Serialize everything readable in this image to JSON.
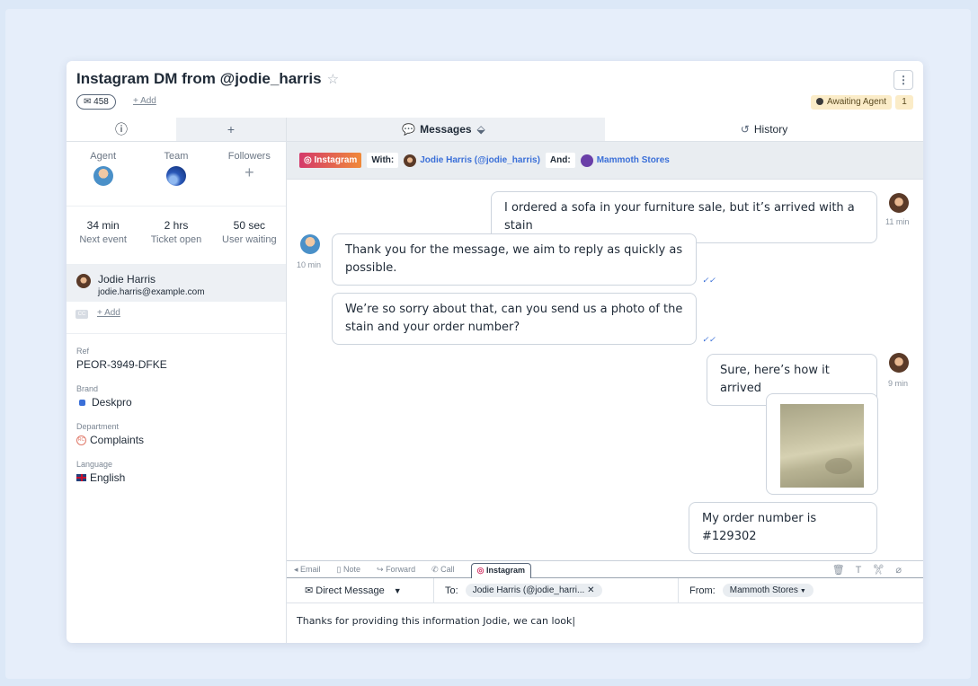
{
  "ticket": {
    "title": "Instagram DM from @jodie_harris",
    "star_icon": "star-icon",
    "message_count": "458",
    "add_label": "+ Add",
    "status": "Awaiting Agent",
    "status_count": "1",
    "more_icon": "⋮"
  },
  "sidebar": {
    "tabs": [
      "ⓘ",
      "+"
    ],
    "people": [
      {
        "label": "Agent"
      },
      {
        "label": "Team"
      },
      {
        "label": "Followers",
        "value": "+"
      }
    ],
    "stats": [
      {
        "value": "34 min",
        "label": "Next event"
      },
      {
        "value": "2 hrs",
        "label": "Ticket open"
      },
      {
        "value": "50 sec",
        "label": "User waiting"
      }
    ],
    "contact": {
      "name": "Jodie Harris",
      "email": "jodie.harris@example.com"
    },
    "cc_label": "CC",
    "cc_add": "+ Add",
    "fields": [
      {
        "label": "Ref",
        "value": "PEOR-3949-DFKE"
      },
      {
        "label": "Brand",
        "value": "Deskpro"
      },
      {
        "label": "Department",
        "value": "Complaints",
        "icon_text": "RC"
      },
      {
        "label": "Language",
        "value": "English"
      }
    ]
  },
  "main": {
    "tabs": [
      {
        "label": "Messages",
        "icon": "chat-icon"
      },
      {
        "label": "History",
        "icon": "history-icon"
      }
    ],
    "context": {
      "channel": "Instagram",
      "with_label": "With:",
      "with_value": "Jodie Harris (@jodie_harris)",
      "and_label": "And:",
      "and_value": "Mammoth Stores"
    },
    "messages": [
      {
        "text": "I ordered a sofa in your furniture sale, but it’s arrived with a stain",
        "time": "11 min",
        "from": "user"
      },
      {
        "text": "Thank you for the message, we aim to reply as quickly as possible.",
        "time": "10 min",
        "from": "agent"
      },
      {
        "text": "We’re so sorry about that, can you send us a photo of the stain and your order number?",
        "from": "agent"
      },
      {
        "text": "Sure, here’s how it arrived",
        "time": "9 min",
        "from": "user"
      },
      {
        "text": "My order number is #129302",
        "from": "user"
      }
    ]
  },
  "composer": {
    "tabs": [
      "Email",
      "Note",
      "Forward",
      "Call",
      "Instagram"
    ],
    "active_tab": "Instagram",
    "mode": "Direct Message",
    "to_label": "To:",
    "to_value": "Jodie Harris (@jodie_harri...",
    "from_label": "From:",
    "from_value": "Mammoth Stores",
    "text": "Thanks for providing this information Jodie, we can look|"
  },
  "colors": {
    "background": "#dce8f7",
    "accent": "#3a6fd8",
    "status_bg": "#fbecc8",
    "instagram": "#d4396a"
  }
}
